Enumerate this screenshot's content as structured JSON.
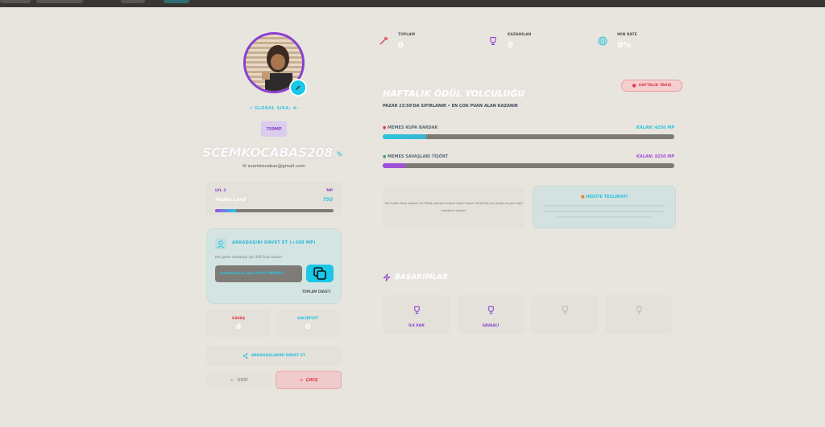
{
  "profile": {
    "rank_label": "GLOBAL SIRA:",
    "rank_value": "#-",
    "mp_badge": "750MP",
    "username": "SCEMKOCABAS208",
    "email": "scemkocabas@gmail.com"
  },
  "level": {
    "level_label": "LVL 3",
    "mp_label": "MP",
    "title": "Meme Lord",
    "mp_value": "750",
    "progress": 0.18
  },
  "invite": {
    "title": "ARKADAŞINI DAVET ET (+200 MP)",
    "subtitle": "Her gelen arkadaşın için 200 Puan kazan!",
    "link": "memesocial.com/?ref=7W8V6U",
    "total_label": "TOPLAM DAVET:"
  },
  "stats": {
    "battle_label": "SAVAŞ",
    "battle_value": "0",
    "win_label": "GALİBİYET",
    "win_value": "0",
    "battle_color": "#e0404f",
    "win_color": "#29c4e0"
  },
  "actions": {
    "share_label": "ARKADAŞLARINI DAVET ET",
    "back_label": "GERİ",
    "logout_label": "ÇIKIŞ"
  },
  "kpis": [
    {
      "label": "TOPLAM",
      "value": "0",
      "icon": "sword-icon"
    },
    {
      "label": "KAZANILAN",
      "value": "0",
      "icon": "trophy-icon"
    },
    {
      "label": "WIN RATE",
      "value": "0%",
      "icon": "target-icon"
    }
  ],
  "weekly": {
    "badge": "HAFTALIK YARIŞ",
    "title": "HAFTALIK ÖDÜL YOLCULUĞU",
    "subtitle": "PAZAR 23:59'DA SIFIRLANIR • EN ÇOK PUAN ALAN KAZANIR",
    "prizes": [
      {
        "name": "MEMES KUPA BARDAK",
        "remaining": "KALAN: 4250 MP",
        "progress": 0.15,
        "accent": "#29c4e0"
      },
      {
        "name": "MEMES SAVAŞLARI TİŞÖRT",
        "remaining": "KALAN: 9250 MP",
        "progress": 0.08,
        "accent": "#a14de0"
      }
    ],
    "note": "Her hafta Pazar akşamı 23:59'da puanlar kontrol edilir. Pazar'ı 00:00'da yeni hafta ve yeni ödül maratonu başlar!",
    "delivery_title": "HEDİYE TESLİMATI"
  },
  "achievements": {
    "title": "BAŞARIMLAR",
    "items": [
      {
        "label": "İLK KAN",
        "active": true
      },
      {
        "label": "SAVAŞÇI",
        "active": true
      },
      {
        "label": "",
        "active": false
      },
      {
        "label": "",
        "active": false
      }
    ]
  }
}
